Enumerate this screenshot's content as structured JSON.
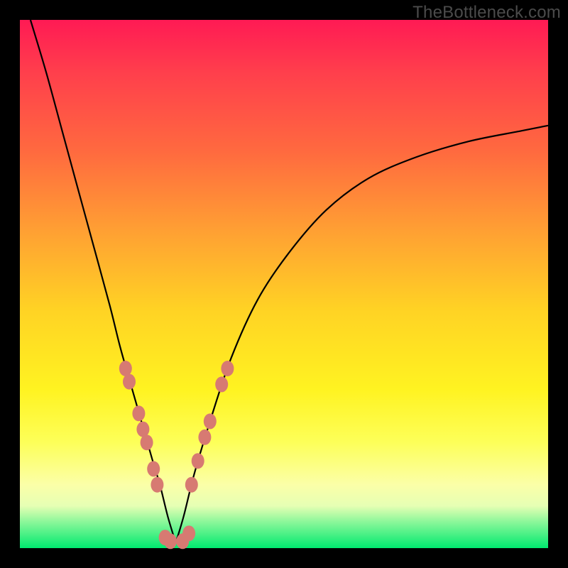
{
  "watermark": "TheBottleneck.com",
  "colors": {
    "frame": "#000000",
    "gradient_top": "#ff1a54",
    "gradient_mid": "#fff321",
    "gradient_bottom": "#00e96f",
    "curve": "#000000",
    "dot": "#d77a72"
  },
  "chart_data": {
    "type": "line",
    "title": "",
    "xlabel": "",
    "ylabel": "",
    "xlim": [
      0,
      100
    ],
    "ylim": [
      0,
      100
    ],
    "series": [
      {
        "name": "left-curve",
        "x": [
          2,
          5,
          8,
          11,
          14,
          17,
          19,
          21,
          23,
          25,
          26.5,
          28,
          29.5
        ],
        "y": [
          100,
          90,
          79,
          68,
          57,
          46,
          38,
          31,
          24,
          17,
          12,
          6,
          1
        ]
      },
      {
        "name": "right-curve",
        "x": [
          29.5,
          31,
          33,
          36,
          40,
          45,
          51,
          58,
          66,
          75,
          85,
          95,
          100
        ],
        "y": [
          1,
          6,
          14,
          24,
          36,
          47,
          56,
          64,
          70,
          74,
          77,
          79,
          80
        ]
      }
    ],
    "points_left": [
      {
        "x": 20.0,
        "y": 34.0
      },
      {
        "x": 20.7,
        "y": 31.5
      },
      {
        "x": 22.5,
        "y": 25.5
      },
      {
        "x": 23.3,
        "y": 22.5
      },
      {
        "x": 24.0,
        "y": 20.0
      },
      {
        "x": 25.3,
        "y": 15.0
      },
      {
        "x": 26.0,
        "y": 12.0
      }
    ],
    "points_right": [
      {
        "x": 32.5,
        "y": 12.0
      },
      {
        "x": 33.7,
        "y": 16.5
      },
      {
        "x": 35.0,
        "y": 21.0
      },
      {
        "x": 36.0,
        "y": 24.0
      },
      {
        "x": 38.2,
        "y": 31.0
      },
      {
        "x": 39.3,
        "y": 34.0
      }
    ],
    "points_bottom": [
      {
        "x": 27.5,
        "y": 2.0
      },
      {
        "x": 28.5,
        "y": 1.3
      },
      {
        "x": 30.8,
        "y": 1.3
      },
      {
        "x": 32.0,
        "y": 2.8
      }
    ]
  }
}
